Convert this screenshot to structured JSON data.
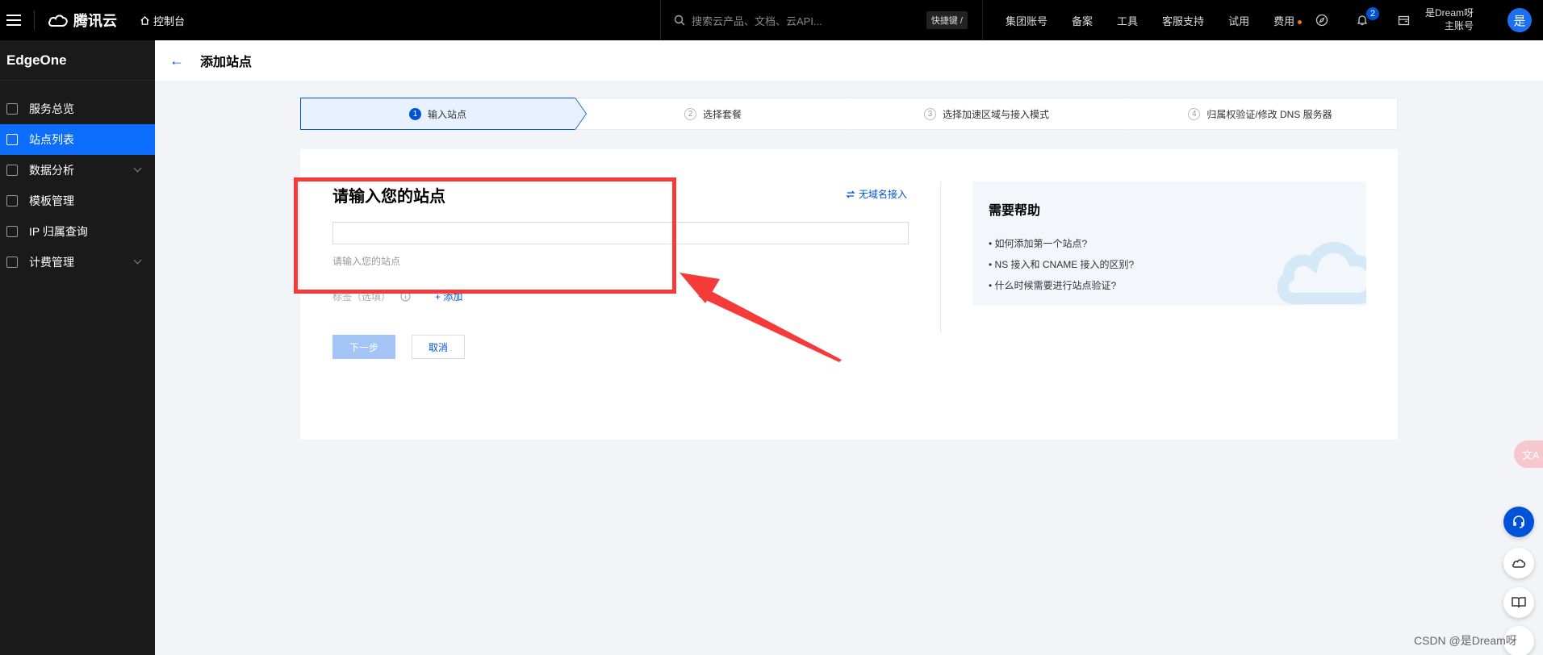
{
  "topbar": {
    "brand": "腾讯云",
    "console": "控制台",
    "search_placeholder": "搜索云产品、文档、云API...",
    "shortcut": "快捷键 /",
    "nav": [
      "集团账号",
      "备案",
      "工具",
      "客服支持",
      "试用",
      "费用"
    ],
    "notification_count": "2",
    "account_name": "是Dream呀",
    "account_role": "主账号",
    "avatar_text": "是"
  },
  "sidebar": {
    "product": "EdgeOne",
    "items": [
      {
        "label": "服务总览"
      },
      {
        "label": "站点列表"
      },
      {
        "label": "数据分析"
      },
      {
        "label": "模板管理"
      },
      {
        "label": "IP 归属查询"
      },
      {
        "label": "计费管理"
      }
    ]
  },
  "header": {
    "back": "←",
    "title": "添加站点"
  },
  "steps": [
    {
      "num": "1",
      "label": "输入站点"
    },
    {
      "num": "2",
      "label": "选择套餐"
    },
    {
      "num": "3",
      "label": "选择加速区域与接入模式"
    },
    {
      "num": "4",
      "label": "归属权验证/修改 DNS 服务器"
    }
  ],
  "form": {
    "title": "请输入您的站点",
    "no_domain": "无域名接入",
    "site_placeholder": "",
    "hint": "请输入您的站点",
    "tag_label": "标签（选填）",
    "tag_add": "+ 添加",
    "next": "下一步",
    "cancel": "取消"
  },
  "help": {
    "title": "需要帮助",
    "links": [
      "如何添加第一个站点?",
      "NS 接入和 CNAME 接入的区别?",
      "什么时候需要进行站点验证?"
    ]
  },
  "float": {
    "translate": "文A"
  },
  "watermark": "CSDN @是Dream呀",
  "colors": {
    "accent": "#0052d9",
    "annotation": "#f53a3a",
    "sidebar_bg": "#1a1a1a"
  }
}
